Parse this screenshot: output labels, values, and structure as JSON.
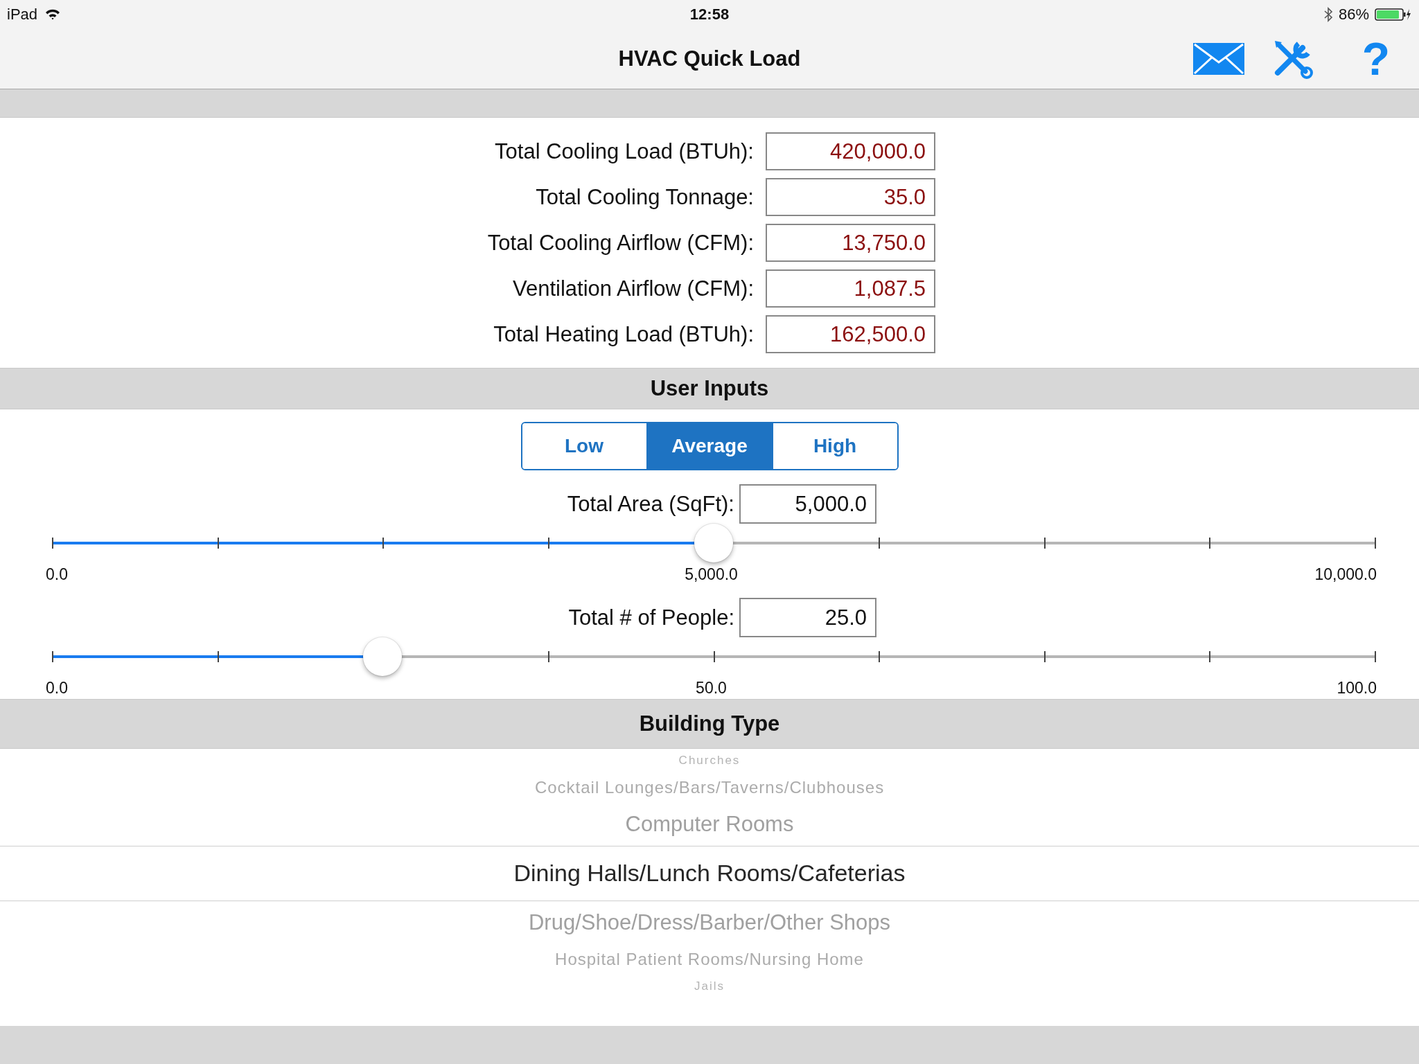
{
  "status_bar": {
    "device": "iPad",
    "time": "12:58",
    "battery": "86%"
  },
  "nav_bar": {
    "title": "HVAC Quick Load",
    "help": "?"
  },
  "results": [
    {
      "label": "Total Cooling Load (BTUh):",
      "value": "420,000.0"
    },
    {
      "label": "Total Cooling Tonnage:",
      "value": "35.0"
    },
    {
      "label": "Total Cooling Airflow (CFM):",
      "value": "13,750.0"
    },
    {
      "label": "Ventilation Airflow (CFM):",
      "value": "1,087.5"
    },
    {
      "label": "Total Heating Load (BTUh):",
      "value": "162,500.0"
    }
  ],
  "user_inputs": {
    "title": "User Inputs",
    "segments": [
      {
        "label": "Low",
        "selected": false
      },
      {
        "label": "Average",
        "selected": true
      },
      {
        "label": "High",
        "selected": false
      }
    ],
    "inputs": [
      {
        "label": "Total Area (SqFt):",
        "value": "5,000.0",
        "level": 0.5,
        "tick_labels": [
          "0.0",
          "5,000.0",
          "10,000.0"
        ]
      },
      {
        "label": "Total # of People:",
        "value": "25.0",
        "level": 0.25,
        "tick_labels": [
          "0.0",
          "50.0",
          "100.0"
        ]
      }
    ]
  },
  "building_type": {
    "title": "Building Type",
    "items": [
      {
        "label": "Churches",
        "selected": false
      },
      {
        "label": "Cocktail Lounges/Bars/Taverns/Clubhouses",
        "selected": false
      },
      {
        "label": "Computer Rooms",
        "selected": false
      },
      {
        "label": "Dining Halls/Lunch Rooms/Cafeterias",
        "selected": true
      },
      {
        "label": "Drug/Shoe/Dress/Barber/Other Shops",
        "selected": false
      },
      {
        "label": "Hospital Patient Rooms/Nursing Home",
        "selected": false
      },
      {
        "label": "Jails",
        "selected": false
      }
    ]
  }
}
